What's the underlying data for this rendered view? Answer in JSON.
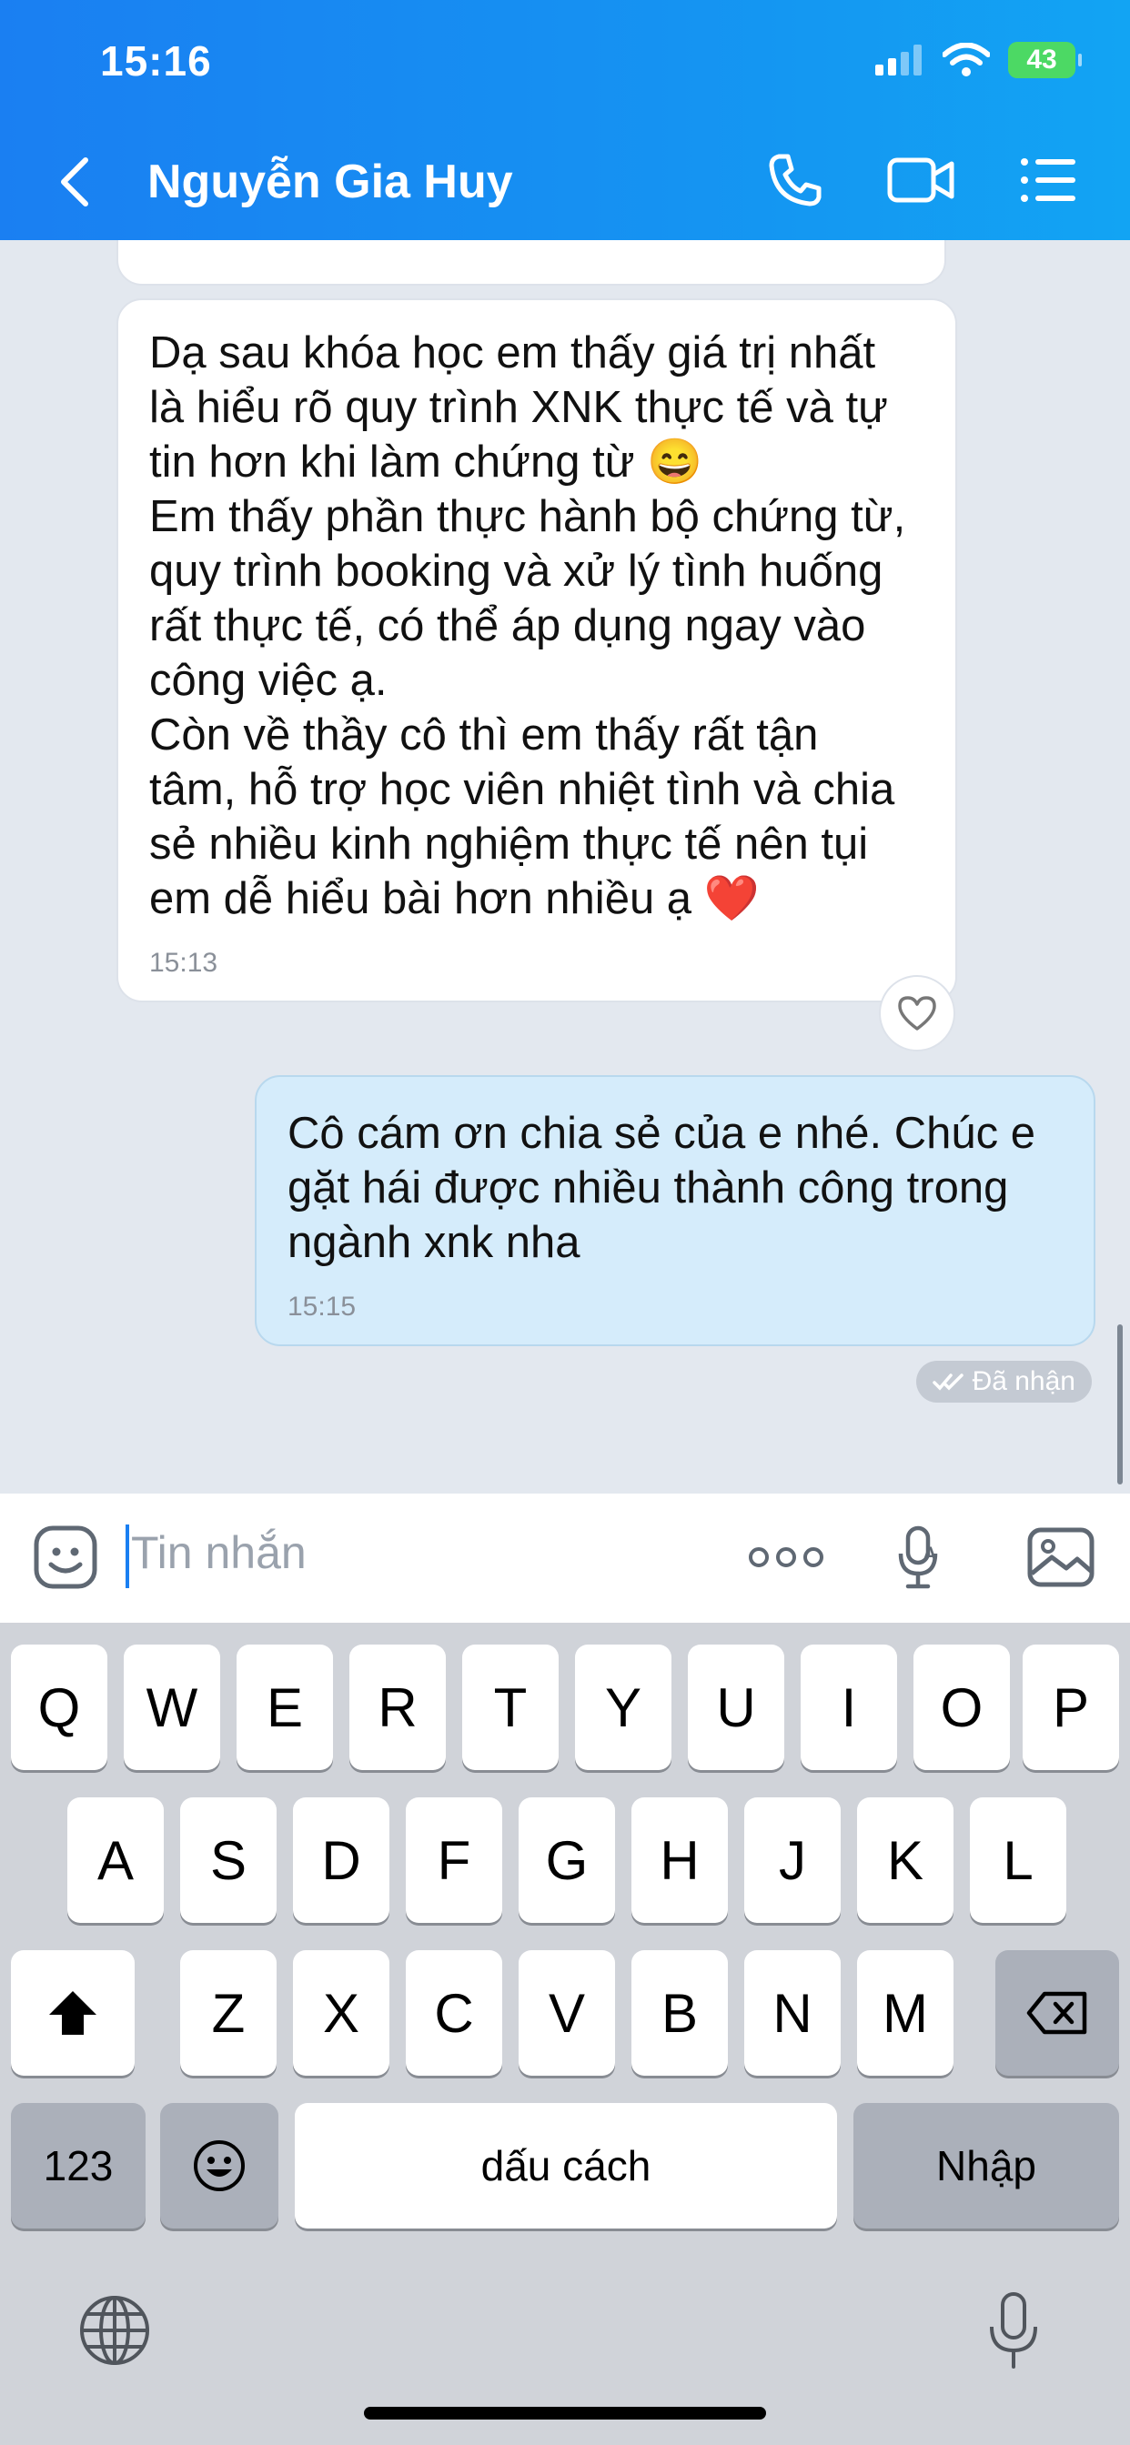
{
  "status_bar": {
    "time": "15:16",
    "battery": "43"
  },
  "header": {
    "contact_name": "Nguyễn Gia Huy",
    "icons": [
      "back-chevron-icon",
      "phone-icon",
      "video-call-icon",
      "menu-list-icon"
    ]
  },
  "messages": [
    {
      "direction": "incoming",
      "text": "Dạ sau khóa học em thấy giá trị nhất\nlà hiểu rõ quy trình XNK thực tế và tự\ntin hơn khi làm chứng từ 😄\nEm thấy phần thực hành bộ chứng từ,\nquy trình booking và xử lý tình huống\nrất thực tế, có thể áp dụng ngay vào\ncông việc ạ.\nCòn về thầy cô thì em thấy rất tận\ntâm, hỗ trợ học viên nhiệt tình và chia\nsẻ nhiều kinh nghiệm thực tế nên tụi\nem dễ hiểu bài hơn nhiều ạ ❤️",
      "time": "15:13"
    },
    {
      "direction": "outgoing",
      "text": "Cô cám ơn chia sẻ của e nhé. Chúc e\ngặt hái được nhiều thành công trong\nngành xnk nha",
      "time": "15:15"
    }
  ],
  "receipt": "Đã nhận",
  "input": {
    "placeholder": "Tin nhắn"
  },
  "keyboard": {
    "row1": [
      "Q",
      "W",
      "E",
      "R",
      "T",
      "Y",
      "U",
      "I",
      "O",
      "P"
    ],
    "row2": [
      "A",
      "S",
      "D",
      "F",
      "G",
      "H",
      "J",
      "K",
      "L"
    ],
    "row3": [
      "Z",
      "X",
      "C",
      "V",
      "B",
      "N",
      "M"
    ],
    "numbers_key": "123",
    "space_key": "dấu cách",
    "return_key": "Nhập"
  },
  "colors": {
    "header_gradient_start": "#1a7ff2",
    "outgoing_bubble": "#d5ecfb",
    "chat_bg": "#e3e8ef"
  }
}
